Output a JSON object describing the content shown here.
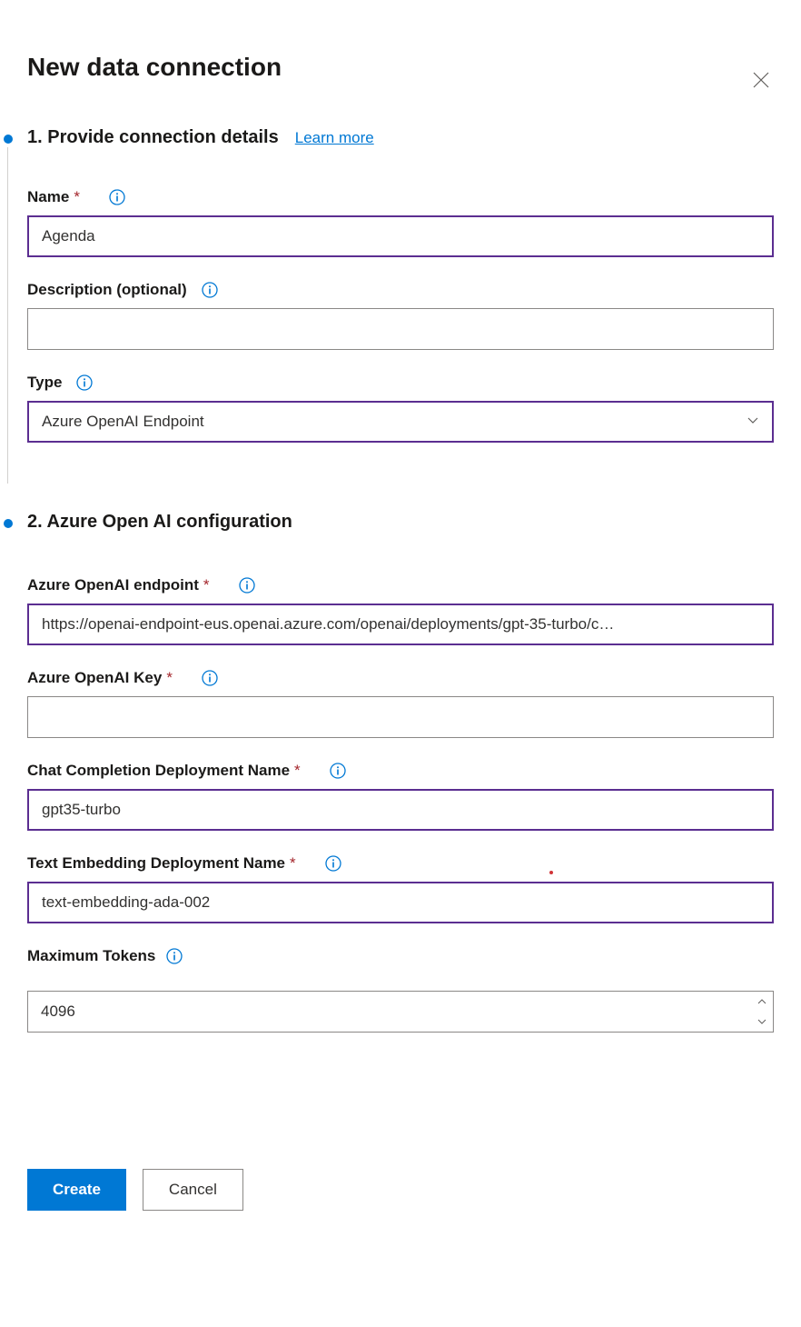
{
  "header": {
    "title": "New data connection"
  },
  "step1": {
    "title": "1. Provide connection details",
    "learn_more": "Learn more",
    "fields": {
      "name_label": "Name",
      "name_value": "Agenda",
      "description_label": "Description (optional)",
      "description_value": "",
      "type_label": "Type",
      "type_value": "Azure OpenAI Endpoint"
    }
  },
  "step2": {
    "title": "2. Azure Open AI configuration",
    "fields": {
      "endpoint_label": "Azure OpenAI endpoint",
      "endpoint_value": "https://openai-endpoint-eus.openai.azure.com/openai/deployments/gpt-35-turbo/c…",
      "key_label": "Azure OpenAI Key",
      "key_value": "",
      "chat_label": "Chat Completion Deployment Name",
      "chat_value": "gpt35-turbo",
      "embedding_label": "Text Embedding Deployment Name",
      "embedding_value": "text-embedding-ada-002",
      "tokens_label": "Maximum Tokens",
      "tokens_value": "4096"
    }
  },
  "buttons": {
    "create": "Create",
    "cancel": "Cancel"
  }
}
